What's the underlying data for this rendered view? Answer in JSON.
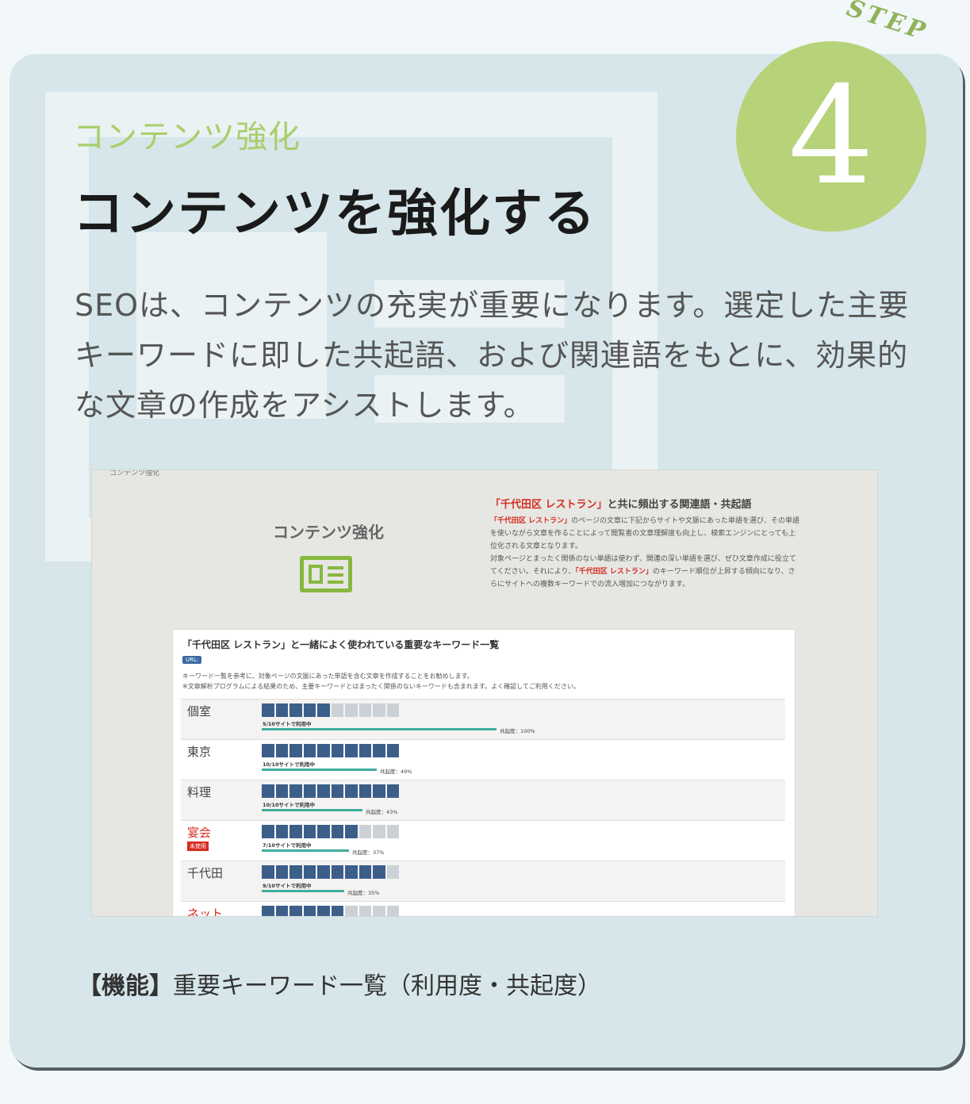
{
  "step": {
    "label": "STEP",
    "number": "4"
  },
  "header": {
    "subtitle": "コンテンツ強化",
    "title": "コンテンツを強化する"
  },
  "description": "SEOは、コンテンツの充実が重要になります。選定した主要キーワードに即した共起語、および関連語をもとに、効果的な文章の作成をアシストします。",
  "screenshot": {
    "corner_label": "コンテンツ強化",
    "section_heading": "コンテンツ強化",
    "related": {
      "title_kw": "「千代田区 レストラン」",
      "title_rest": "と共に頻出する関連語・共起語",
      "para1_kw": "「千代田区 レストラン」",
      "para1_rest": "のページの文章に下記からサイトや文脈にあった単語を選び、その単語を使いながら文章を作ることによって閲覧者の文章理解度も向上し、検索エンジンにとっても上位化される文章となります。",
      "para2_a": "対象ページとまったく関係のない単語は使わず、関連の深い単語を選び、ぜひ文章作成に役立ててください。それにより、",
      "para2_kw": "「千代田区 レストラン」",
      "para2_b": "のキーワード順位が上昇する傾向になり、さらにサイトへの複数キーワードでの流入増加につながります。"
    },
    "keyword_list": {
      "title": "「千代田区 レストラン」と一緒によく使われている重要なキーワード一覧",
      "url_tag": "URL:",
      "note1": "キーワード一覧を参考に、対象ページの文脈にあった単語を含む文章を作成することをお勧めします。",
      "note2": "※文章解析プログラムによる結果のため、主要キーワードとはまったく関係のないキーワードも含まれます。よく確認してご利用ください。",
      "rows": [
        {
          "keyword": "個室",
          "sites_text": "5/10サイトで利用中",
          "used": 5,
          "cooccurrence_text": "共起度：100%",
          "cooccurrence": 100,
          "highlight": false,
          "badge": ""
        },
        {
          "keyword": "東京",
          "sites_text": "10/10サイトで利用中",
          "used": 10,
          "cooccurrence_text": "共起度：49%",
          "cooccurrence": 49,
          "highlight": false,
          "badge": ""
        },
        {
          "keyword": "料理",
          "sites_text": "10/10サイトで利用中",
          "used": 10,
          "cooccurrence_text": "共起度：43%",
          "cooccurrence": 43,
          "highlight": false,
          "badge": ""
        },
        {
          "keyword": "宴会",
          "sites_text": "7/10サイトで利用中",
          "used": 7,
          "cooccurrence_text": "共起度：37%",
          "cooccurrence": 37,
          "highlight": true,
          "badge": "未使用"
        },
        {
          "keyword": "千代田",
          "sites_text": "9/10サイトで利用中",
          "used": 9,
          "cooccurrence_text": "共起度：35%",
          "cooccurrence": 35,
          "highlight": false,
          "badge": ""
        },
        {
          "keyword": "ネット",
          "sites_text": "",
          "used": 6,
          "cooccurrence_text": "",
          "cooccurrence": 0,
          "highlight": true,
          "badge": ""
        }
      ]
    }
  },
  "caption": {
    "label": "【機能】",
    "text": "重要キーワード一覧（利用度・共起度）"
  }
}
